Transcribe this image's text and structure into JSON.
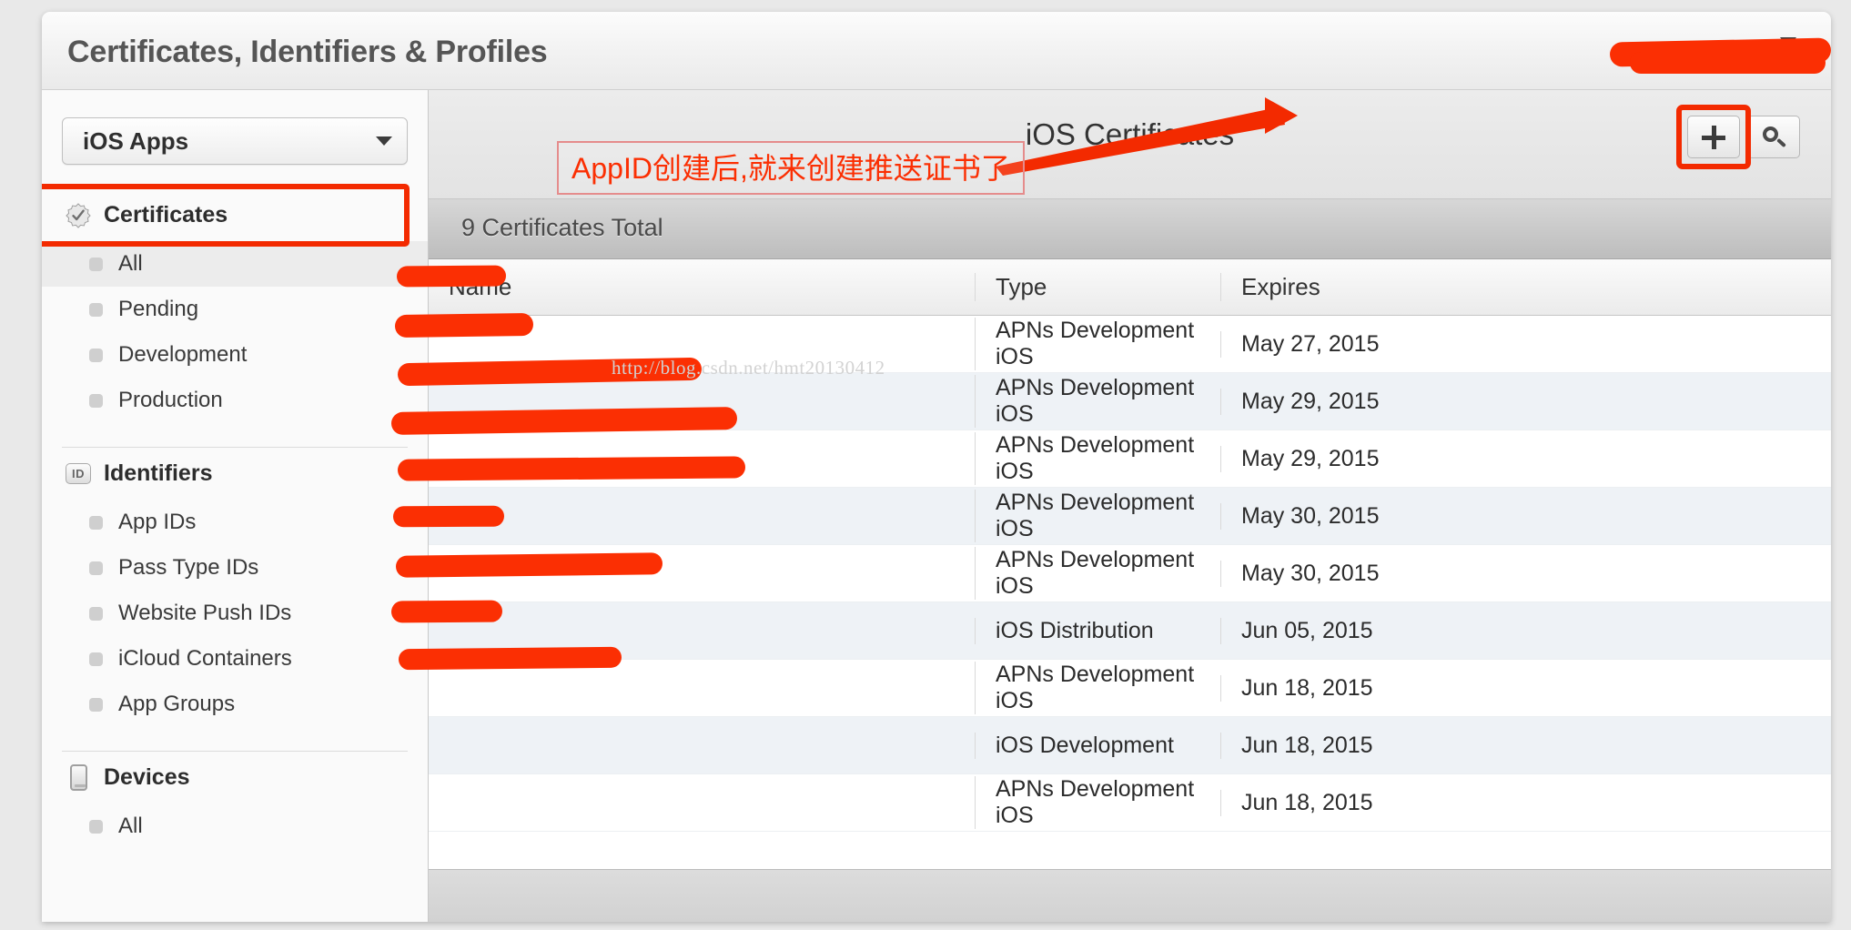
{
  "window": {
    "app_title": "Certificates, Identifiers & Profiles",
    "account_name": "",
    "account_chevron_icon": "chevron-down-icon"
  },
  "sidebar": {
    "app_select": {
      "label": "iOS Apps",
      "caret_icon": "caret-down-icon"
    },
    "groups": [
      {
        "label": "Certificates",
        "icon": "certificate-seal-icon",
        "highlighted": true,
        "items": [
          {
            "label": "All",
            "active": true
          },
          {
            "label": "Pending",
            "active": false
          },
          {
            "label": "Development",
            "active": false
          },
          {
            "label": "Production",
            "active": false
          }
        ]
      },
      {
        "label": "Identifiers",
        "icon": "id-badge-icon",
        "highlighted": false,
        "items": [
          {
            "label": "App IDs",
            "active": false
          },
          {
            "label": "Pass Type IDs",
            "active": false
          },
          {
            "label": "Website Push IDs",
            "active": false
          },
          {
            "label": "iCloud Containers",
            "active": false
          },
          {
            "label": "App Groups",
            "active": false
          }
        ]
      },
      {
        "label": "Devices",
        "icon": "device-phone-icon",
        "highlighted": false,
        "items": [
          {
            "label": "All",
            "active": false
          }
        ]
      }
    ]
  },
  "main": {
    "title": "iOS Certificates",
    "add_button_icon": "plus-icon",
    "search_button_icon": "search-icon",
    "count_label": "9 Certificates Total",
    "columns": [
      "Name",
      "Type",
      "Expires"
    ],
    "rows": [
      {
        "name": "",
        "type": "APNs Development iOS",
        "expires": "May 27, 2015"
      },
      {
        "name": "",
        "type": "APNs Development iOS",
        "expires": "May 29, 2015"
      },
      {
        "name": "",
        "type": "APNs Development iOS",
        "expires": "May 29, 2015"
      },
      {
        "name": "",
        "type": "APNs Development iOS",
        "expires": "May 30, 2015"
      },
      {
        "name": "",
        "type": "APNs Development iOS",
        "expires": "May 30, 2015"
      },
      {
        "name": "",
        "type": "iOS Distribution",
        "expires": "Jun 05, 2015"
      },
      {
        "name": "",
        "type": "APNs Development iOS",
        "expires": "Jun 18, 2015"
      },
      {
        "name": "",
        "type": "iOS Development",
        "expires": "Jun 18, 2015"
      },
      {
        "name": "",
        "type": "APNs Development iOS",
        "expires": "Jun 18, 2015"
      }
    ]
  },
  "annotations": {
    "callout_text": "AppID创建后,就来创建推送证书了",
    "callout_color": "#fb2f03",
    "highlight_color": "#f32a00",
    "arrow_icon": "arrow-pointing-right-icon"
  },
  "watermark": {
    "text": "http://blog.csdn.net/hmt20130412"
  }
}
